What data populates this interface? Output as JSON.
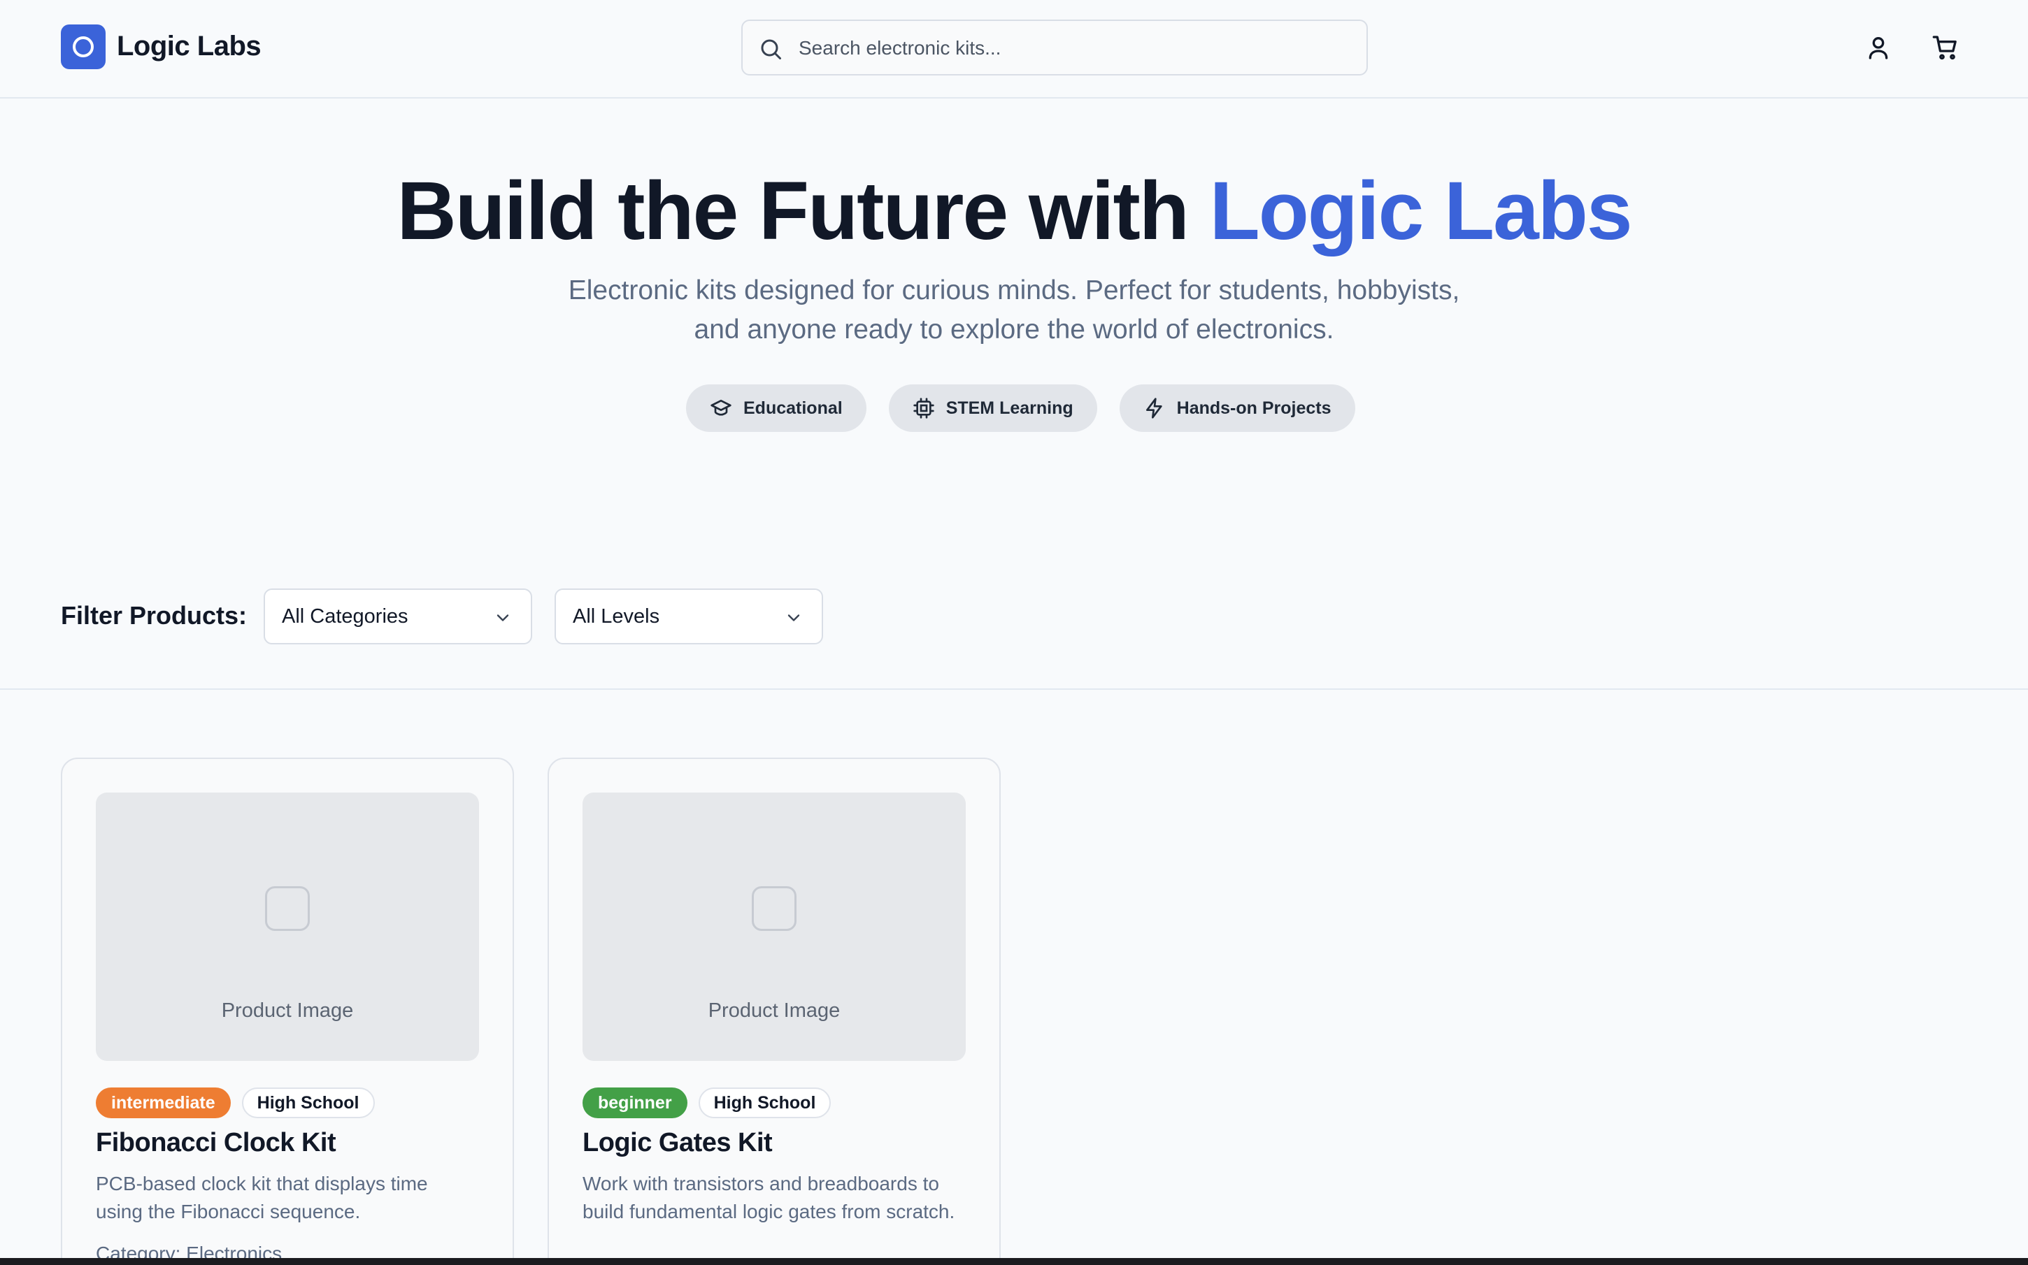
{
  "header": {
    "brand": "Logic Labs",
    "search_placeholder": "Search electronic kits...",
    "account_icon": "user-icon",
    "cart_icon": "cart-icon"
  },
  "hero": {
    "title_main": "Build the Future with ",
    "title_accent": "Logic Labs",
    "subtitle_line1": "Electronic kits designed for curious minds. Perfect for students, hobbyists,",
    "subtitle_line2": "and anyone ready to explore the world of electronics.",
    "pills": [
      {
        "label": "Educational",
        "icon": "graduation-cap-icon"
      },
      {
        "label": "STEM Learning",
        "icon": "cpu-chip-icon"
      },
      {
        "label": "Hands-on Projects",
        "icon": "lightning-icon"
      }
    ]
  },
  "filters": {
    "label": "Filter Products:",
    "category_value": "All Categories",
    "level_value": "All Levels"
  },
  "products": [
    {
      "image_label": "Product Image",
      "level": "intermediate",
      "audience": "High School",
      "name": "Fibonacci Clock Kit",
      "description": "PCB-based clock kit that displays time using the Fibonacci sequence.",
      "category": "Category: Electronics"
    },
    {
      "image_label": "Product Image",
      "level": "beginner",
      "audience": "High School",
      "name": "Logic Gates Kit",
      "description": "Work with transistors and breadboards to build fundamental logic gates from scratch.",
      "category": ""
    }
  ],
  "colors": {
    "accent": "#3b63d9",
    "intermediate_badge": "#ee7d32",
    "beginner_badge": "#43a047"
  }
}
